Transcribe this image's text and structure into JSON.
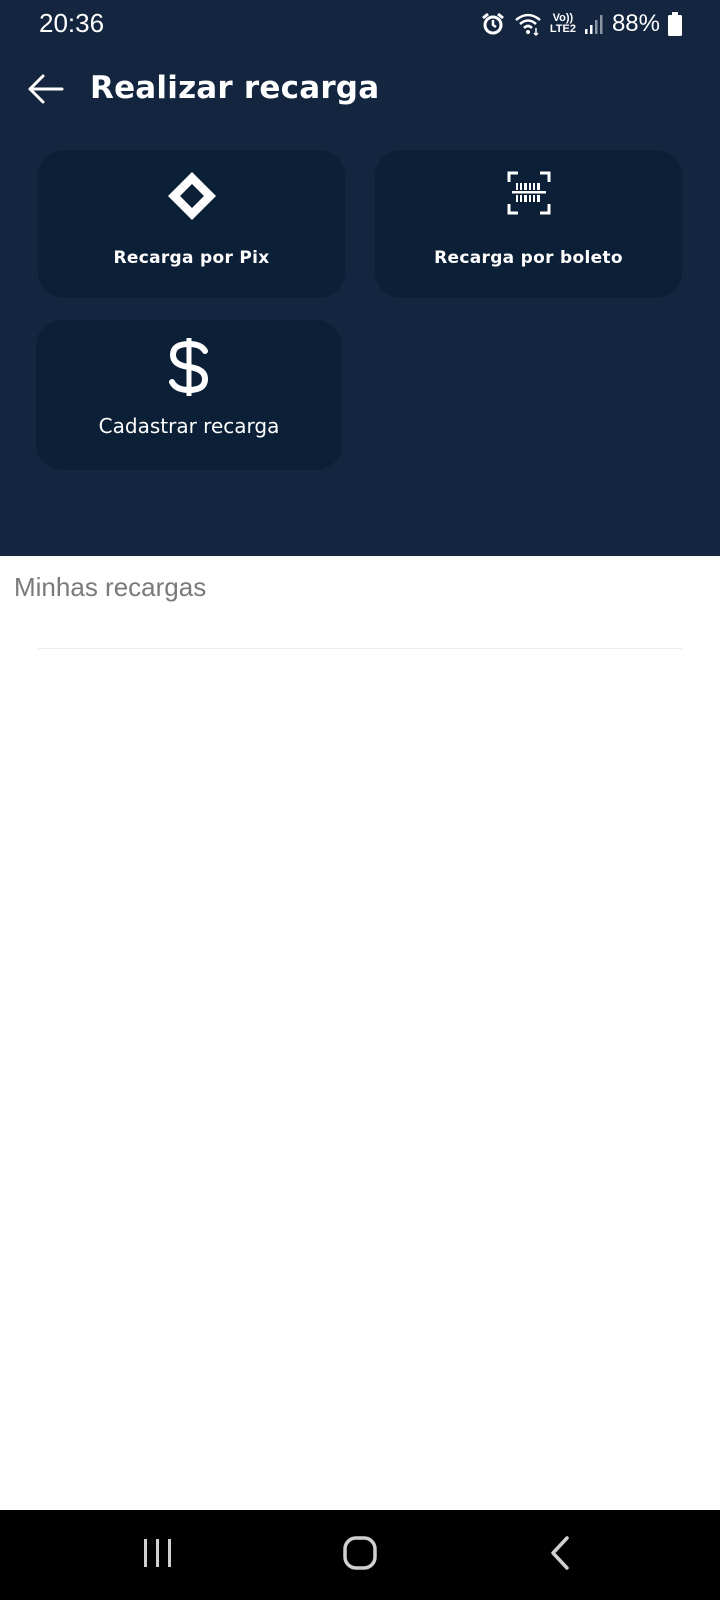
{
  "status_bar": {
    "time": "20:36",
    "battery_percent": "88%",
    "network_label_top": "Vo))",
    "network_label_bottom": "LTE2",
    "icons": [
      "alarm-icon",
      "wifi-icon",
      "volte-icon",
      "signal-icon",
      "battery-icon"
    ]
  },
  "app_bar": {
    "title": "Realizar recarga",
    "back_icon": "arrow-left-icon"
  },
  "actions": [
    {
      "label": "Recarga por Pix",
      "icon": "pix-icon"
    },
    {
      "label": "Recarga por boleto",
      "icon": "barcode-scan-icon"
    },
    {
      "label": "Cadastrar recarga",
      "icon": "dollar-icon"
    }
  ],
  "section": {
    "title": "Minhas recargas"
  },
  "nav_bar": {
    "buttons": [
      "recents-icon",
      "home-icon",
      "back-icon"
    ]
  },
  "colors": {
    "header_bg": "#13253f",
    "card_bg": "#0b1f36",
    "section_title": "#7a7a7a",
    "nav_bg": "#000000"
  }
}
